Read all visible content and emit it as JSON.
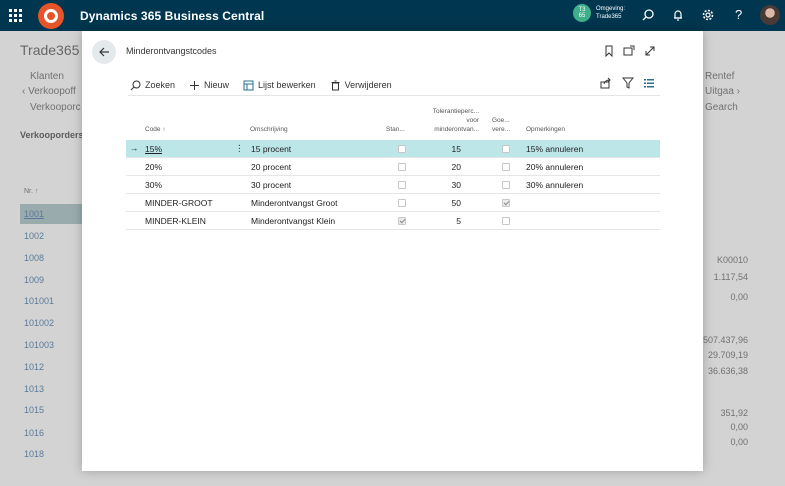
{
  "appbar": {
    "title": "Dynamics 365 Business Central",
    "env_label": "Omgeving:",
    "env_name": "Trade365",
    "env_badge_top": "T3",
    "env_badge_bottom": "65",
    "icons": [
      "waffle-icon",
      "search-icon",
      "bell-icon",
      "gear-icon",
      "help-icon"
    ],
    "help_label": "?"
  },
  "background": {
    "title": "Trade365",
    "nav": [
      "Klanten",
      "Verkoopoff",
      "Verkooporc"
    ],
    "nav_right": [
      "Rentef",
      "Uitgaa",
      "Gearch"
    ],
    "section": "Verkooporders:",
    "col_nr": "Nr. ↑",
    "numbers": [
      "1001",
      "1002",
      "1008",
      "1009",
      "101001",
      "101002",
      "101003",
      "1012",
      "1013",
      "1015",
      "1016",
      "1018"
    ],
    "right_values": [
      "K00010",
      "1.117,54",
      "0,00",
      "507.437,96",
      "29.709,19",
      "36.636,38",
      "351,92",
      "0,00",
      "0,00"
    ]
  },
  "modal": {
    "title": "Minderontvangstcodes",
    "toolbar": {
      "search": "Zoeken",
      "new": "Nieuw",
      "edit_list": "Lijst bewerken",
      "delete": "Verwijderen"
    },
    "columns": {
      "code": "Code ↑",
      "description": "Omschrijving",
      "standard": "Stan...",
      "tolerance_l1": "Tolerantieperc...",
      "tolerance_l2": "voor",
      "tolerance_l3": "minderontvan...",
      "blocked_l1": "Goe...",
      "blocked_l2": "vere...",
      "remarks": "Opmerkingen"
    },
    "rows": [
      {
        "code": "15%",
        "description": "15 procent",
        "standard": false,
        "tolerance": "15",
        "blocked": false,
        "remarks": "15% annuleren"
      },
      {
        "code": "20%",
        "description": "20 procent",
        "standard": false,
        "tolerance": "20",
        "blocked": false,
        "remarks": "20% annuleren"
      },
      {
        "code": "30%",
        "description": "30 procent",
        "standard": false,
        "tolerance": "30",
        "blocked": false,
        "remarks": "30% annuleren"
      },
      {
        "code": "MINDER-GROOT",
        "description": "Minderontvangst Groot",
        "standard": false,
        "tolerance": "50",
        "blocked": true,
        "remarks": ""
      },
      {
        "code": "MINDER-KLEIN",
        "description": "Minderontvangst Klein",
        "standard": true,
        "tolerance": "5",
        "blocked": false,
        "remarks": ""
      }
    ],
    "selected_row": 0,
    "row_marker": "→",
    "row_menu": "⋮"
  },
  "colors": {
    "appbar": "#00364f",
    "accent": "#00838f",
    "selected_row": "#bde6e9",
    "logo": "#e8542a"
  }
}
